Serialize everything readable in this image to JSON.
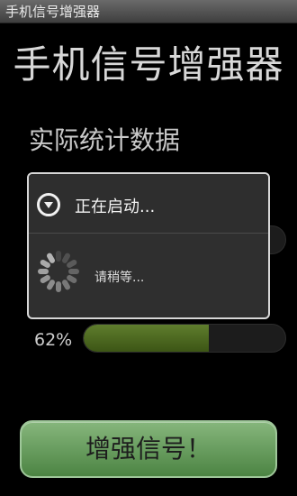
{
  "window": {
    "title": "手机信号增强器"
  },
  "app": {
    "title": "手机信号增强器"
  },
  "stats": {
    "title": "实际统计数据",
    "bar1_percent_label": "",
    "bar1_fraction": 0.0,
    "bar2_percent_label": "62%",
    "bar2_fraction": 0.62
  },
  "boost_button": {
    "label": "增强信号！"
  },
  "dialog": {
    "title": "正在启动...",
    "message": "请稍等...",
    "icon": "chevron-down-circle-icon"
  },
  "colors": {
    "progress_fill": "#4a6a1f",
    "button_green": "#5e9a55"
  }
}
